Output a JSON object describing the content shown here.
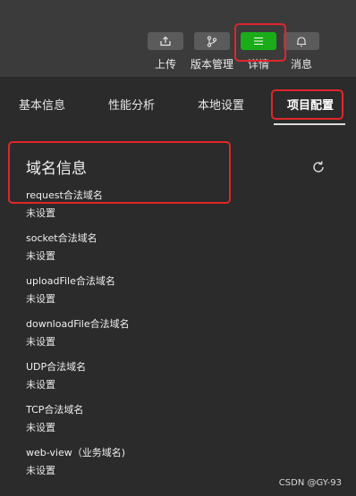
{
  "toolbar": {
    "upload_label": "上传",
    "version_label": "版本管理",
    "details_label": "详情",
    "messages_label": "消息"
  },
  "tabs": [
    "基本信息",
    "性能分析",
    "本地设置",
    "项目配置"
  ],
  "section": {
    "title": "域名信息"
  },
  "domains": [
    {
      "name": "request合法域名",
      "value": "未设置"
    },
    {
      "name": "socket合法域名",
      "value": "未设置"
    },
    {
      "name": "uploadFile合法域名",
      "value": "未设置"
    },
    {
      "name": "downloadFile合法域名",
      "value": "未设置"
    },
    {
      "name": "UDP合法域名",
      "value": "未设置"
    },
    {
      "name": "TCP合法域名",
      "value": "未设置"
    },
    {
      "name": "web-view（业务域名)",
      "value": "未设置"
    }
  ],
  "watermark": "CSDN @GY-93",
  "colors": {
    "active_button": "#1aad19",
    "highlight_box": "#e0262b"
  }
}
